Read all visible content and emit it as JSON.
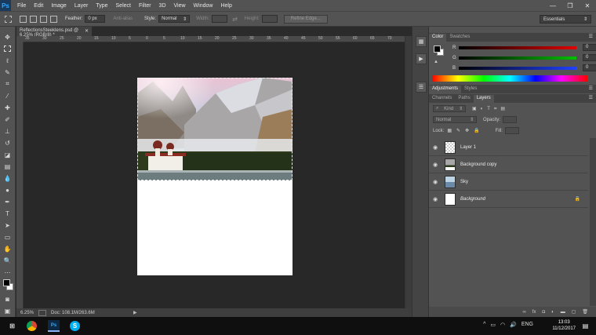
{
  "app": {
    "logo": "Ps"
  },
  "menu": [
    "File",
    "Edit",
    "Image",
    "Layer",
    "Type",
    "Select",
    "Filter",
    "3D",
    "View",
    "Window",
    "Help"
  ],
  "window_controls": [
    "—",
    "❐",
    "✕"
  ],
  "options": {
    "feather_label": "Feather:",
    "feather_value": "0 px",
    "antialias_label": "Anti-alias",
    "style_label": "Style:",
    "style_value": "Normal",
    "width_label": "Width:",
    "height_label": "Height:",
    "refine_edge": "Refine Edge...",
    "workspace": "Essentials"
  },
  "document": {
    "tab_title": "ReflectionsSteeklens.psd @ 6.25% (RGB/8) *",
    "close": "✕",
    "ruler_ticks": [
      "35",
      "30",
      "25",
      "20",
      "15",
      "10",
      "5",
      "0",
      "5",
      "10",
      "15",
      "20",
      "25",
      "30",
      "35",
      "40",
      "45",
      "50",
      "55",
      "60",
      "65",
      "70"
    ]
  },
  "status": {
    "zoom": "6.25%",
    "doc": "Doc: 108.1M/263.6M"
  },
  "color_panel": {
    "tabs": [
      "Color",
      "Swatches"
    ],
    "channels": [
      {
        "label": "R",
        "value": "0",
        "color": "#e00000"
      },
      {
        "label": "G",
        "value": "0",
        "color": "#00c000"
      },
      {
        "label": "B",
        "value": "0",
        "color": "#2040ff"
      }
    ]
  },
  "adjustments_panel": {
    "tabs": [
      "Adjustments",
      "Styles"
    ]
  },
  "layers_panel": {
    "tabs": [
      "Channels",
      "Paths",
      "Layers"
    ],
    "filter_kind": "Kind",
    "blend_mode": "Normal",
    "opacity_label": "Opacity:",
    "lock_label": "Lock:",
    "fill_label": "Fill:",
    "layers": [
      {
        "name": "Layer 1",
        "italic": false,
        "locked": false,
        "thumb": "checker"
      },
      {
        "name": "Background copy",
        "italic": false,
        "locked": false,
        "thumb": "photo"
      },
      {
        "name": "Sky",
        "italic": false,
        "locked": false,
        "thumb": "sky"
      },
      {
        "name": "Background",
        "italic": true,
        "locked": true,
        "thumb": "white"
      }
    ]
  },
  "taskbar": {
    "lang": "ENG",
    "time": "13:03",
    "date": "11/12/2017"
  }
}
